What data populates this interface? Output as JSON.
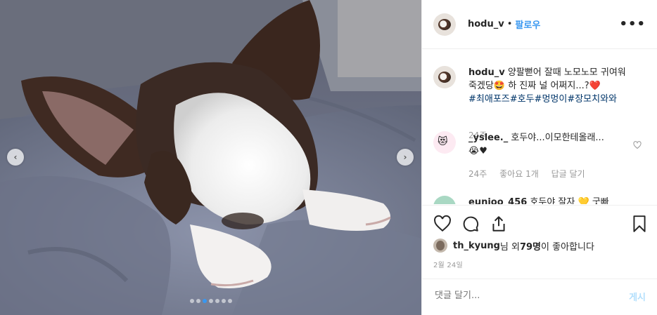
{
  "post": {
    "username": "hodu_v",
    "separator": "•",
    "follow_label": "팔로우",
    "more_icon": "more-options-icon"
  },
  "caption": {
    "username": "hodu_v",
    "text_part1": "양팔뻗어 잘때 노모노모 귀여워죽겠당",
    "emoji1": "🤩",
    "text_part2": " 하 진짜 널 어쩌지...?",
    "emoji2": "❤️",
    "hashtags": "#최애포즈#호두#멍멍이#장모치와와",
    "time": "24주"
  },
  "comments": [
    {
      "username": "_yslee._",
      "text": "호두야...이모한테올래...",
      "emoji": "😭♥",
      "time": "24주",
      "likes": "좋아요 1개",
      "reply": "답글 달기"
    },
    {
      "username": "eunjoo_456",
      "text": "호두야 잘자",
      "emoji": "💛",
      "extra": "굿빠"
    }
  ],
  "likes": {
    "user": "th_kyung",
    "suffix": "님 외 ",
    "count": "79명",
    "tail": "이 좋아합니다"
  },
  "date": "2월 24일",
  "add_comment": {
    "placeholder": "댓글 달기...",
    "post_label": "게시"
  },
  "carousel": {
    "prev": "‹",
    "next": "›",
    "total_slides": 7,
    "active_slide": 2
  },
  "colors": {
    "link": "#3897f0",
    "hashtag": "#003569",
    "muted": "#999999",
    "post_disabled": "#b2dffc"
  }
}
